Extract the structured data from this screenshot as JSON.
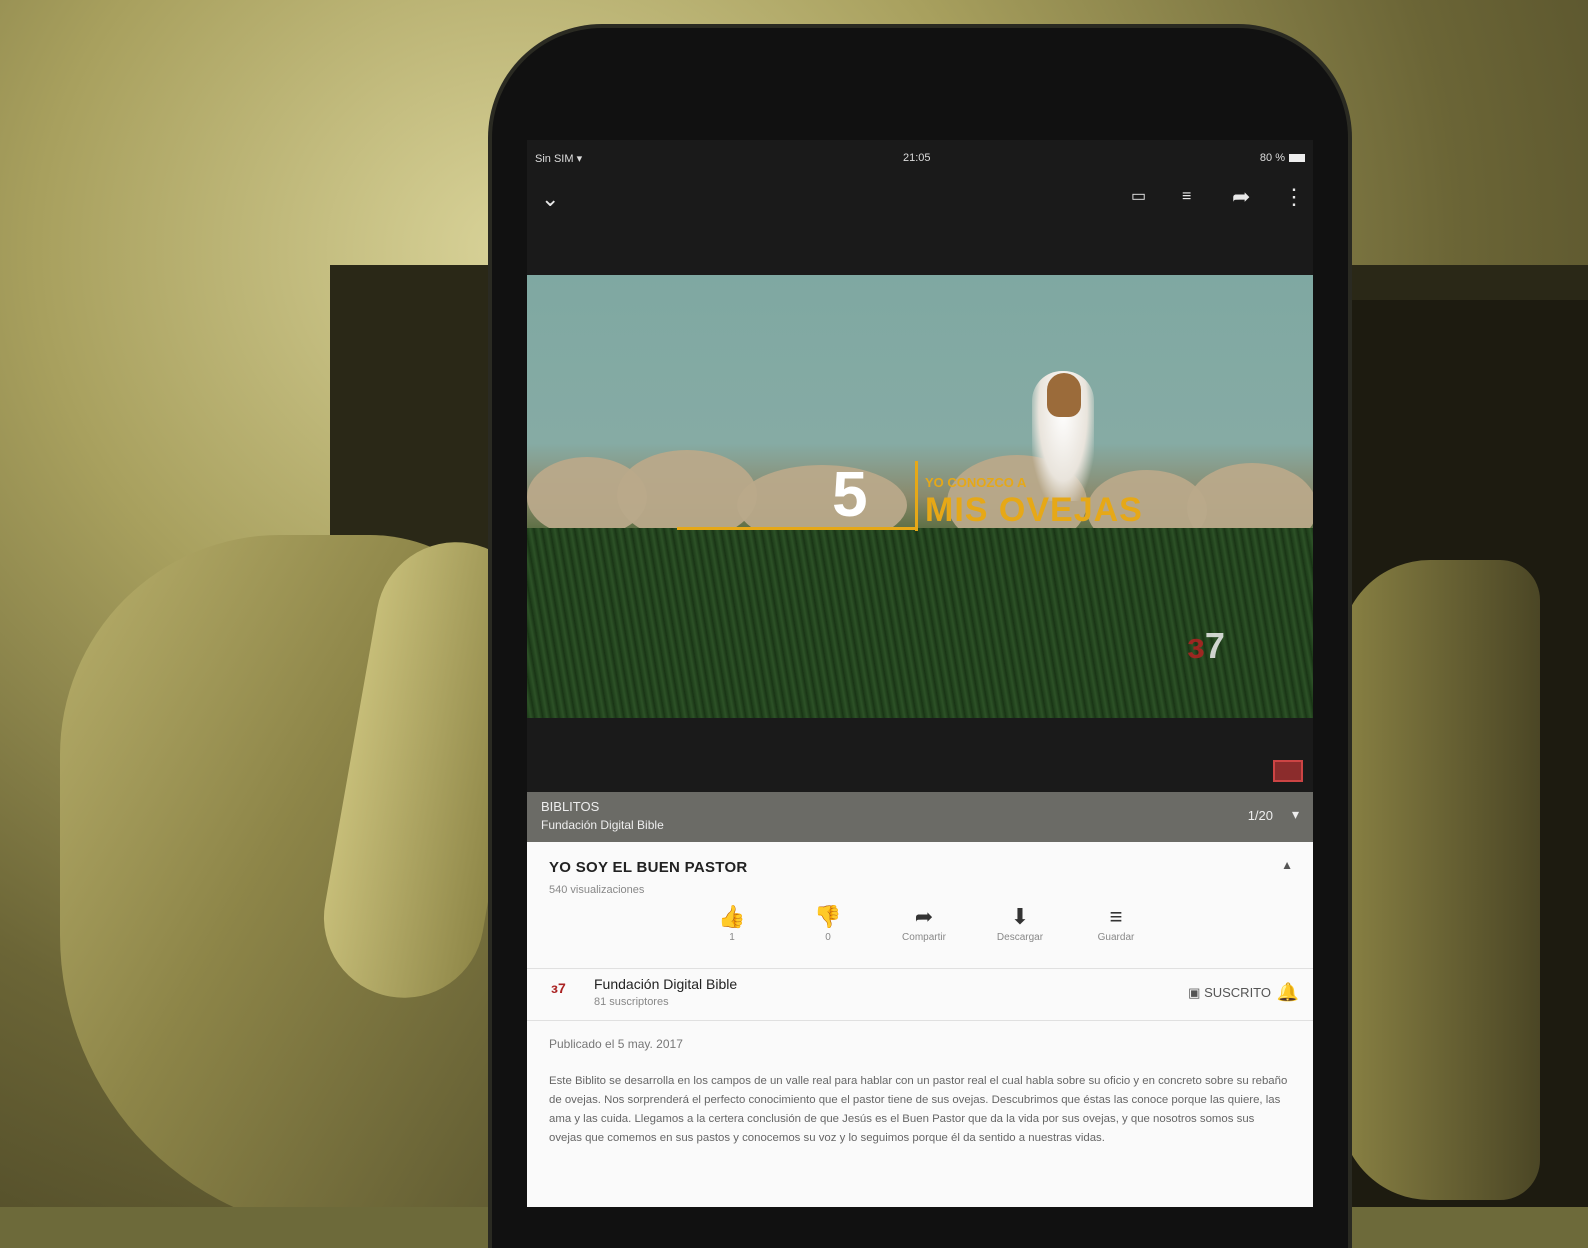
{
  "status_bar": {
    "carrier": "Sin SIM ▾",
    "time": "21:05",
    "battery": "80 %"
  },
  "video_overlay": {
    "number": "5",
    "small_text": "YO CONOZCO A",
    "big_text": "MIS OVEJAS"
  },
  "playlist": {
    "title": "BIBLITOS",
    "channel": "Fundación Digital Bible",
    "position": "1/20"
  },
  "video": {
    "title": "YO SOY EL BUEN PASTOR",
    "views": "540 visualizaciones",
    "actions": [
      {
        "icon": "thumbs-up-icon",
        "label": "1"
      },
      {
        "icon": "thumbs-down-icon",
        "label": "0"
      },
      {
        "icon": "share-icon",
        "label": "Compartir"
      },
      {
        "icon": "download-icon",
        "label": "Descargar"
      },
      {
        "icon": "save-icon",
        "label": "Guardar"
      }
    ]
  },
  "channel": {
    "name": "Fundación Digital Bible",
    "subscribers": "81 suscriptores",
    "subscribe_label": "SUSCRITO"
  },
  "description": {
    "published": "Publicado el 5 may. 2017",
    "text": "Este Biblito se desarrolla en los campos de un valle real para hablar con un pastor real el cual habla sobre su oficio y en concreto sobre su rebaño de ovejas. Nos sorprenderá el perfecto conocimiento que el pastor tiene de sus ovejas. Descubrimos que éstas las conoce porque las quiere, las ama y las cuida. Llegamos a la certera conclusión de que Jesús es el Buen Pastor que da la vida por sus ovejas, y que nosotros somos sus ovejas que comemos en sus pastos y conocemos su voz y lo seguimos porque él da sentido a nuestras vidas."
  }
}
